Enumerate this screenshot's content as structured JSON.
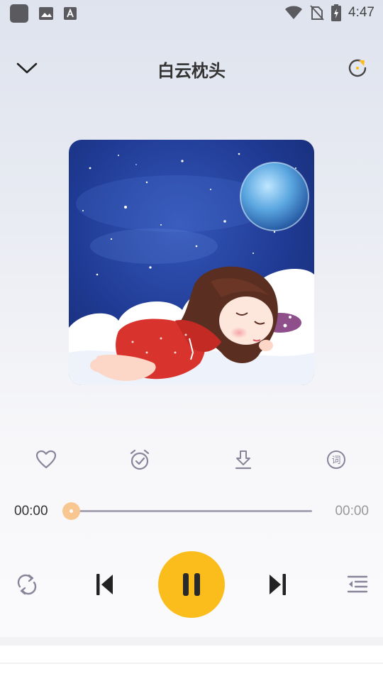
{
  "status_bar": {
    "time": "4:47",
    "left_icons": [
      "app-icon",
      "gallery-icon",
      "keyboard-a-icon"
    ],
    "right_icons": [
      "wifi-icon",
      "no-sim-icon",
      "battery-charging-icon"
    ]
  },
  "header": {
    "title": "白云枕头",
    "back_icon": "chevron-down-icon",
    "right_icon": "refresh-icon"
  },
  "cover": {
    "icon": "album-cover-sleeping-girl-image"
  },
  "actions": [
    {
      "name": "like",
      "icon": "heart-icon"
    },
    {
      "name": "timer",
      "icon": "alarm-clock-icon"
    },
    {
      "name": "download",
      "icon": "download-icon"
    },
    {
      "name": "lyrics",
      "icon": "lyrics-icon",
      "glyph": "词"
    }
  ],
  "progress": {
    "current": "00:00",
    "total": "00:00",
    "fraction": 0
  },
  "controls": {
    "loop_icon": "repeat-icon",
    "prev_icon": "skip-previous-icon",
    "play_icon": "pause-icon",
    "next_icon": "skip-next-icon",
    "playlist_icon": "playlist-icon"
  },
  "colors": {
    "accent": "#fbbd1c",
    "progress_thumb": "#f8c690",
    "text": "#333333",
    "muted": "#999999"
  }
}
